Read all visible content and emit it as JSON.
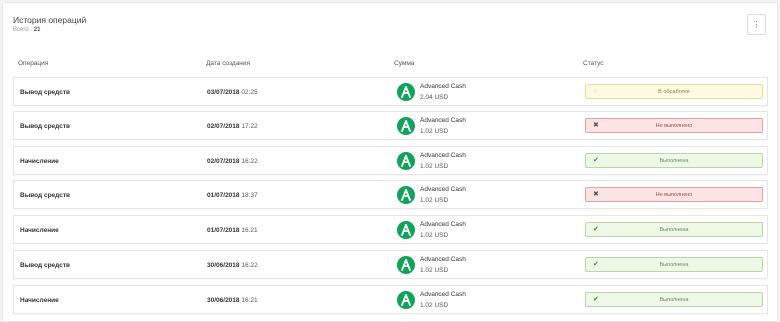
{
  "header": {
    "title": "История операций",
    "total_label": "Всего :",
    "total_count": "21",
    "menu_icon": "⋮"
  },
  "columns": {
    "operation": "Операция",
    "created": "Дата создания",
    "amount": "Сумма",
    "status": "Статус"
  },
  "rows": [
    {
      "operation": "Вывод средств",
      "date": "03/07/2018",
      "time": "02:25",
      "provider": "Advanced Cash",
      "amount": "2.04 USD",
      "status": "В обработке",
      "status_type": "pending",
      "status_icon": "spinner-icon"
    },
    {
      "operation": "Вывод средств",
      "date": "02/07/2018",
      "time": "17:22",
      "provider": "Advanced Cash",
      "amount": "1.02 USD",
      "status": "Не выполнено",
      "status_type": "failed",
      "status_icon": "x-icon"
    },
    {
      "operation": "Начисление",
      "date": "02/07/2018",
      "time": "16:22",
      "provider": "Advanced Cash",
      "amount": "1.02 USD",
      "status": "Выполнена",
      "status_type": "success",
      "status_icon": "check-icon"
    },
    {
      "operation": "Вывод средств",
      "date": "01/07/2018",
      "time": "18:37",
      "provider": "Advanced Cash",
      "amount": "1.02 USD",
      "status": "Не выполнено",
      "status_type": "failed",
      "status_icon": "x-icon"
    },
    {
      "operation": "Начисление",
      "date": "01/07/2018",
      "time": "16:21",
      "provider": "Advanced Cash",
      "amount": "1.02 USD",
      "status": "Выполнена",
      "status_type": "success",
      "status_icon": "check-icon"
    },
    {
      "operation": "Вывод средств",
      "date": "30/06/2018",
      "time": "16:22",
      "provider": "Advanced Cash",
      "amount": "1.02 USD",
      "status": "Выполнена",
      "status_type": "success",
      "status_icon": "check-icon"
    },
    {
      "operation": "Начисление",
      "date": "30/06/2018",
      "time": "16:21",
      "provider": "Advanced Cash",
      "amount": "1.02 USD",
      "status": "Выполнена",
      "status_type": "success",
      "status_icon": "check-icon"
    }
  ],
  "colors": {
    "provider_logo": "#12a35a",
    "pending_bg": "#fffbe3",
    "failed_bg": "#fde4e4",
    "success_bg": "#eef8e7"
  }
}
